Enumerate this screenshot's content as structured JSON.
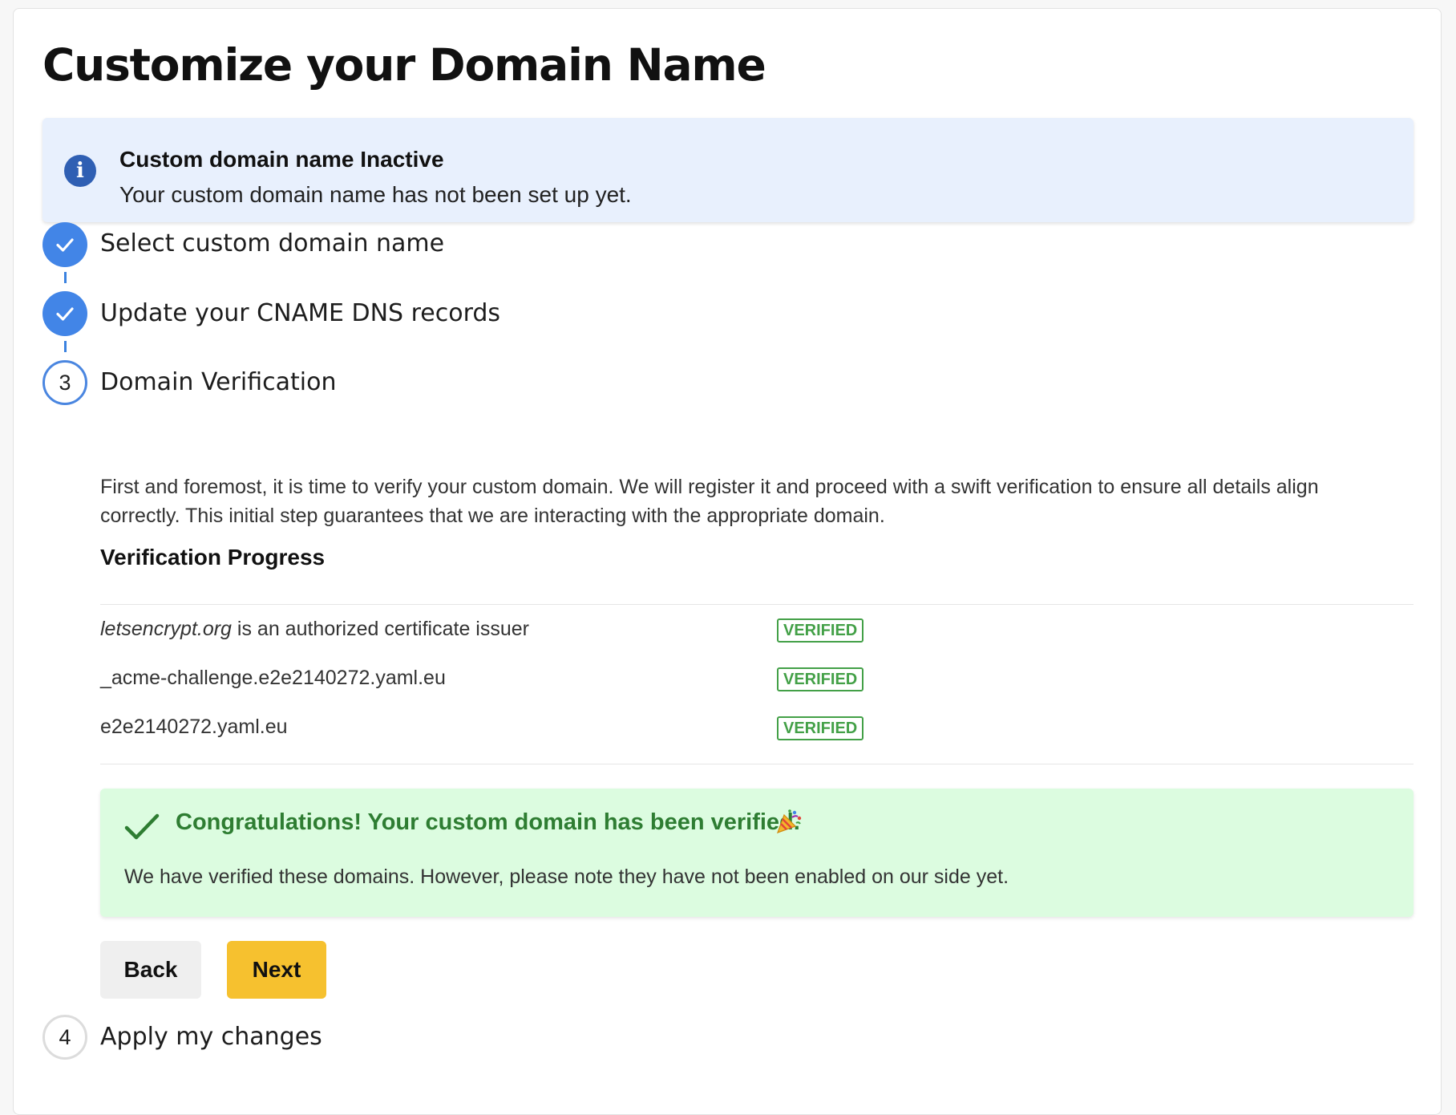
{
  "page": {
    "title": "Customize your Domain Name"
  },
  "info_alert": {
    "icon": "info-icon",
    "glyph": "i",
    "title": "Custom domain name Inactive",
    "text": "Your custom domain name has not been set up yet."
  },
  "steps": [
    {
      "status": "completed",
      "label": "Select custom domain name"
    },
    {
      "status": "completed",
      "label": "Update your CNAME DNS records"
    },
    {
      "status": "active",
      "number": "3",
      "label": "Domain Verification"
    },
    {
      "status": "pending",
      "number": "4",
      "label": "Apply my changes"
    }
  ],
  "verification": {
    "description": "First and foremost, it is time to verify your custom domain. We will register it and proceed with a swift verification to ensure all details align correctly. This initial step guarantees that we are interacting with the appropriate domain.",
    "heading": "Verification Progress",
    "rows": [
      {
        "label_em": "letsencrypt.org",
        "label_rest": " is an authorized certificate issuer",
        "status": "VERIFIED"
      },
      {
        "label_rest": "_acme-challenge.e2e2140272.yaml.eu",
        "status": "VERIFIED"
      },
      {
        "label_rest": "e2e2140272.yaml.eu",
        "status": "VERIFIED"
      }
    ]
  },
  "success_alert": {
    "title": "Congratulations! Your custom domain has been verified.",
    "text": "We have verified these domains. However, please note they have not been enabled on our side yet."
  },
  "buttons": {
    "back": "Back",
    "next": "Next"
  },
  "colors": {
    "primary": "#4285e7",
    "success": "#2e7d32",
    "success_bg": "#dcfce0",
    "info_bg": "#e8f0fd",
    "next_button": "#f6c12f"
  }
}
